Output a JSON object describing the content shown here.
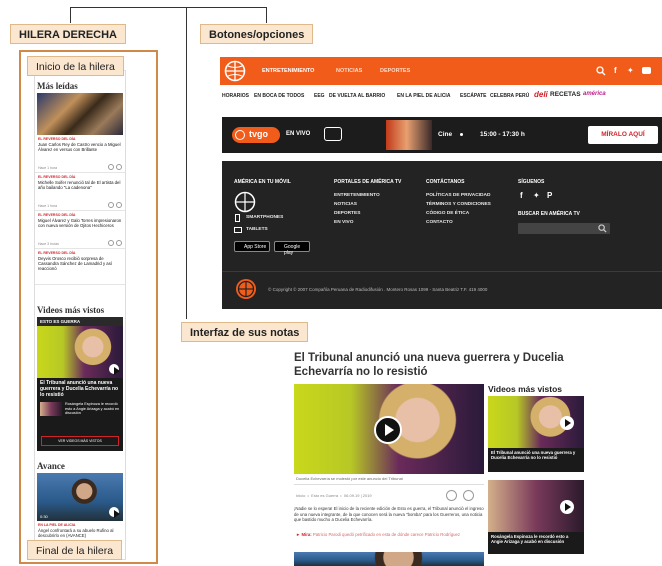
{
  "labels": {
    "right_column": "HILERA DERECHA",
    "buttons_options": "Botones/opciones",
    "notes_interface": "Interfaz de sus notas",
    "row_start": "Inicio de la hilera",
    "row_end": "Final de la hilera"
  },
  "sidebar": {
    "most_read_heading": "Más leídas",
    "news": [
      {
        "category": "EL REVERSO DEL DÍA",
        "title": "Juan Carlos Rey de Castro vencio a Miguel Álvarez en versus con Brillante",
        "time": "Hace 1 hora"
      },
      {
        "category": "EL REVERSO DEL DÍA",
        "title": "Michelle Soifer renunció tal de El artista del año bailando \"La cadenona\"",
        "time": "Hace 1 hora"
      },
      {
        "category": "EL REVERSO DEL DÍA",
        "title": "Miguel Álvarez y Galo Torres impresionaron con nueva versión de Ojitos Hechiceros",
        "time": "Hace 3 horas"
      },
      {
        "category": "EL REVERSO DEL DÍA",
        "title": "Deyvis Orosco recibió sorpresa de Cassandra Sánchez de Lamadrid y así reaccionó",
        "time": "Hace 3 horas"
      }
    ],
    "videos_heading": "Videos más vistos",
    "video_label": "ESTO ES GUERRA",
    "video_title": "El Tribunal anunció una nueva guerrera y Ducelia Echevarría no lo resistió",
    "video_small_title": "Rosángela Espinoza le recordó esto a Angie Arizaga y acabó en discusión",
    "video_button": "VER VIDEOS MÁS VISTOS",
    "avance_heading": "Avance",
    "avance_cat": "EN LA PIEL DE ALICIA",
    "avance_title": "Ángel confrontará a su abuelo Rufino al descubrirlo en (AVANCE)",
    "avance_time": "0:30"
  },
  "site": {
    "nav": [
      "ENTRETENIMIENTO",
      "NOTICIAS",
      "DEPORTES"
    ],
    "subnav": [
      "HORARIOS",
      "EN BOCA DE TODOS",
      "EEG",
      "DE VUELTA AL BARRIO",
      "EN LA PIEL DE ALICIA",
      "ESCÁPATE",
      "CELEBRA PERÚ",
      "deli",
      "RECETAS",
      "américa"
    ],
    "tv": {
      "logo": "tvgo",
      "live": "EN VIVO",
      "program": "Cine",
      "schedule": "15:00 - 17:30 h",
      "watch": "MÍRALO AQUÍ"
    },
    "footer": {
      "mobile_head": "AMÉRICA EN TU MÓVIL",
      "smartphones": "SMARTPHONES",
      "tablets": "TABLETS",
      "appstore": "App Store",
      "googleplay": "Google play",
      "portals_head": "PORTALES DE AMÉRICA TV",
      "portals": [
        "ENTRETENIMIENTO",
        "NOTICIAS",
        "DEPORTES",
        "EN VIVO"
      ],
      "contact_head": "CONTÁCTANOS",
      "contact": [
        "POLÍTICAS DE PRIVACIDAD",
        "TÉRMINOS Y CONDICIONES",
        "CÓDIGO DE ÉTICA",
        "CONTACTO"
      ],
      "follow_head": "SÍGUENOS",
      "search_head": "BUSCAR EN AMÉRICA TV",
      "copyright": "© Copyright © 2007 Compañía Peruana de Radiodifusión . Montero Rosas 1099 - Santa Beatriz T.F. 419 4000"
    }
  },
  "article": {
    "headline": "El Tribunal anunció una nueva guerrera y Ducelia Echevarría no lo resistió",
    "videos_heading": "Videos más vistos",
    "caption": "Ducelia Echevarría se molestó por este anuncio del Tribunal",
    "meta": "Inicio  •  Esto es Guerra  •  06.09.19 | 2019",
    "body": "¡Nadie se lo espera! El inicio de la reciente edición de Esto es guerra, el Tribunal anunció el ingreso de una nueva integrante, de la que conocen será la nueva \"bomba\" para los Guerreros, una noticia que bastido mucho a Ducelia Echevarría.",
    "read_more_label": "► Mira:",
    "read_more": "Patricio Parodi quedó petrificado en esta de dónde carece Patricio Rodríguez",
    "card1": "El Tribunal anunció una nueva guerrera y Ducelia Echevarría no lo resistió",
    "card2": "Rosángela Espinoza le recordó esto a Angie Arizaga y acabó en discusión"
  },
  "colors": {
    "orange": "#f25c1b",
    "dark": "#232323",
    "accent_red": "#d0242b",
    "callout_bg": "#fbe6cf",
    "frame": "#cf8a4a"
  }
}
